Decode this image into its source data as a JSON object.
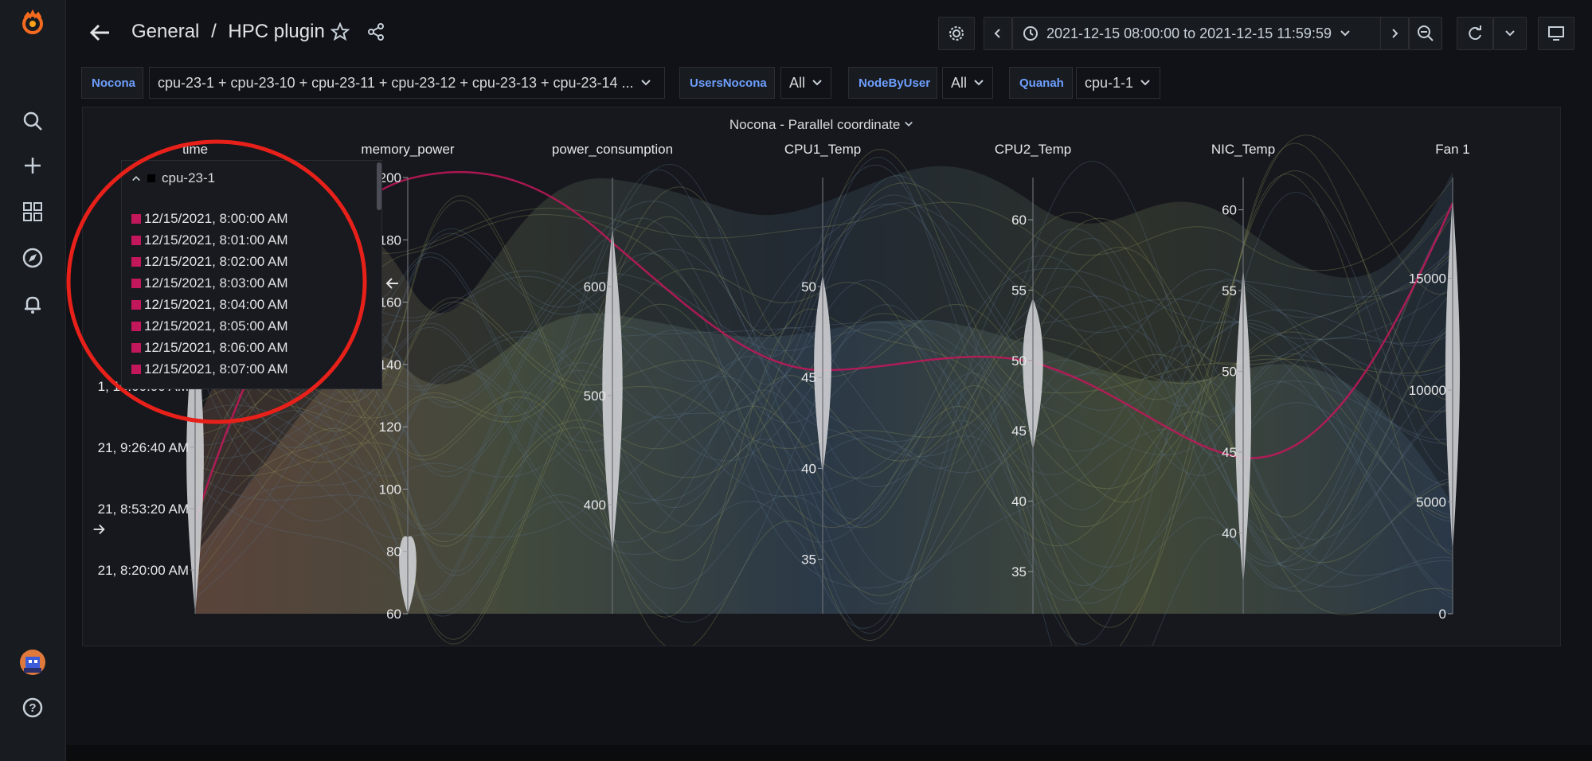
{
  "breadcrumb": {
    "folder": "General",
    "separator": "/",
    "title": "HPC plugin"
  },
  "time_range": {
    "text": "2021-12-15 08:00:00 to 2021-12-15 11:59:59"
  },
  "variables": [
    {
      "label": "Nocona",
      "value": "cpu-23-1 + cpu-23-10 + cpu-23-11 + cpu-23-12 + cpu-23-13 + cpu-23-14 ..."
    },
    {
      "label": "UsersNocona",
      "value": "All"
    },
    {
      "label": "NodeByUser",
      "value": "All"
    },
    {
      "label": "Quanah",
      "value": "cpu-1-1"
    }
  ],
  "panel": {
    "title": "Nocona - Parallel coordinate"
  },
  "sidebar": {
    "icons": [
      "grafana-logo-icon",
      "search-icon",
      "plus-icon",
      "dashboards-icon",
      "explore-compass-icon",
      "alerting-bell-icon",
      "user-avatar",
      "help-icon"
    ]
  },
  "chart_data": {
    "type": "parallel-coordinates",
    "axes": [
      {
        "name": "time",
        "ticks": [
          "1, 10:00:00 AM",
          "21, 9:26:40 AM",
          "21, 8:53:20 AM",
          "21, 8:20:00 AM"
        ]
      },
      {
        "name": "memory_power",
        "ticks": [
          200,
          180,
          160,
          140,
          120,
          100,
          80,
          60
        ],
        "range": [
          60,
          200
        ]
      },
      {
        "name": "power_consumption",
        "ticks": [
          600,
          500,
          400
        ],
        "range": [
          300,
          700
        ]
      },
      {
        "name": "CPU1_Temp",
        "ticks": [
          50,
          45,
          40,
          35
        ],
        "range": [
          32,
          56
        ]
      },
      {
        "name": "CPU2_Temp",
        "ticks": [
          60,
          55,
          50,
          45,
          40,
          35
        ],
        "range": [
          32,
          63
        ]
      },
      {
        "name": "NIC_Temp",
        "ticks": [
          60,
          55,
          50,
          45,
          40
        ],
        "range": [
          35,
          62
        ]
      },
      {
        "name": "Fan 1",
        "ticks": [
          15000,
          10000,
          5000,
          0
        ],
        "range": [
          0,
          19500
        ]
      }
    ],
    "highlight_series": {
      "name": "cpu-23-1",
      "color": "#c2185b"
    },
    "legend": {
      "series": "cpu-23-1",
      "entries": [
        "12/15/2021, 8:00:00 AM",
        "12/15/2021, 8:01:00 AM",
        "12/15/2021, 8:02:00 AM",
        "12/15/2021, 8:03:00 AM",
        "12/15/2021, 8:04:00 AM",
        "12/15/2021, 8:05:00 AM",
        "12/15/2021, 8:06:00 AM",
        "12/15/2021, 8:07:00 AM"
      ]
    }
  },
  "colors": {
    "bg": "#111217",
    "panel": "#16181d",
    "accent_blue": "#6e9fff",
    "highlight": "#c2185b",
    "annotation_red": "#e8201a"
  }
}
